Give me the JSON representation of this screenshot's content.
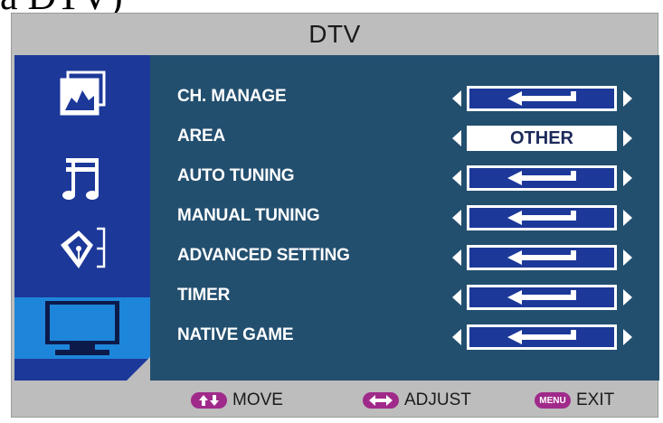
{
  "header_cut_text": "a DTV)",
  "window": {
    "title": "DTV"
  },
  "sidebar": {
    "items": [
      {
        "name": "picture",
        "icon": "picture-icon",
        "selected": false
      },
      {
        "name": "sound",
        "icon": "music-note-icon",
        "selected": false
      },
      {
        "name": "setup",
        "icon": "pen-nib-icon",
        "selected": false
      },
      {
        "name": "tv",
        "icon": "tv-monitor-icon",
        "selected": true
      }
    ]
  },
  "menu": {
    "items": [
      {
        "label": "CH. MANAGE",
        "value_type": "enter",
        "value": ""
      },
      {
        "label": "AREA",
        "value_type": "text",
        "value": "OTHER"
      },
      {
        "label": "AUTO TUNING",
        "value_type": "enter",
        "value": ""
      },
      {
        "label": "MANUAL TUNING",
        "value_type": "enter",
        "value": ""
      },
      {
        "label": "ADVANCED SETTING",
        "value_type": "enter",
        "value": ""
      },
      {
        "label": "TIMER",
        "value_type": "enter",
        "value": ""
      },
      {
        "label": "NATIVE GAME",
        "value_type": "enter",
        "value": ""
      }
    ]
  },
  "footer": {
    "move": {
      "label": "MOVE",
      "key_icon": "up-down-arrows-icon"
    },
    "adjust": {
      "label": "ADJUST",
      "key_icon": "left-right-arrow-icon"
    },
    "exit": {
      "label": "EXIT",
      "key": "MENU"
    }
  },
  "colors": {
    "frame": "#bdbdbd",
    "sidebar": "#1c3899",
    "sidebar_selected": "#1e86da",
    "content": "#234f6f",
    "value_box": "#1c3899",
    "key_pill": "#a02a8a"
  }
}
